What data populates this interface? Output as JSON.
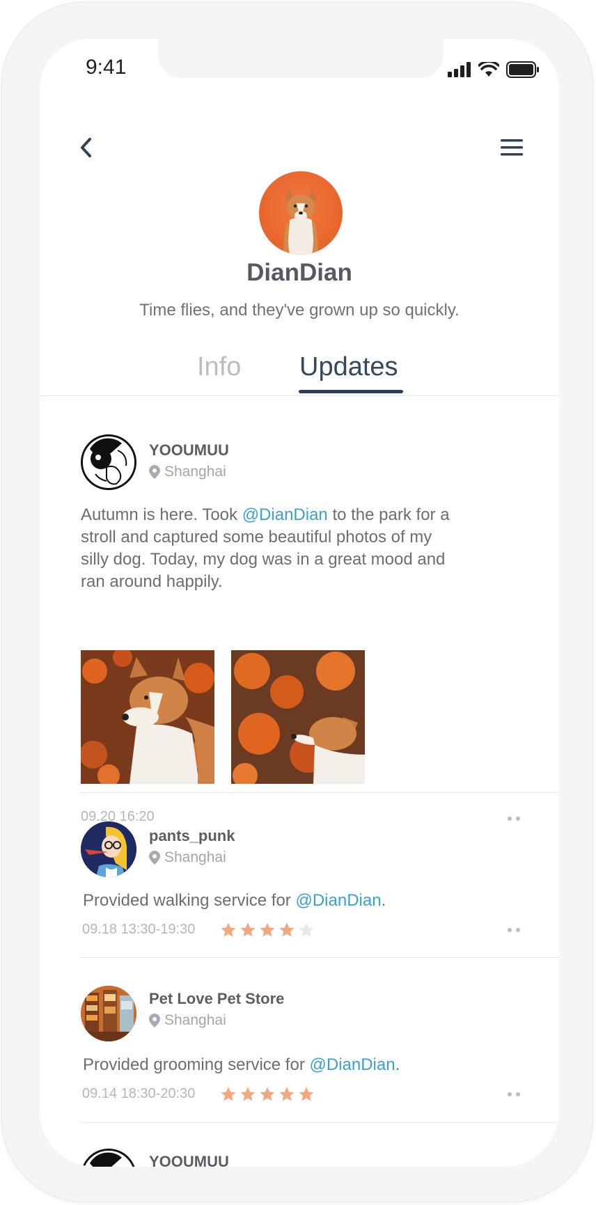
{
  "status": {
    "time": "9:41"
  },
  "profile": {
    "name": "DianDian",
    "bio": "Time flies, and they've grown up so quickly."
  },
  "tabs": [
    {
      "label": "Info",
      "active": false
    },
    {
      "label": "Updates",
      "active": true
    }
  ],
  "posts": [
    {
      "user": "YOOUMUU",
      "location": "Shanghai",
      "text_parts": [
        "Autumn is here. Took ",
        "@DianDian",
        " to the park for a stroll and captured some beautiful photos of my silly dog. Today, my dog was in a great mood and ran around happily."
      ],
      "time": "09.20 16:20"
    },
    {
      "user": "pants_punk",
      "location": "Shanghai",
      "text_parts": [
        "Provided walking service for ",
        "@DianDian",
        "."
      ],
      "time": "09.18 13:30-19:30",
      "rating": 4,
      "rating_max": 5
    },
    {
      "user": "Pet Love Pet Store",
      "location": "Shanghai",
      "text_parts": [
        "Provided grooming service for ",
        "@DianDian",
        "."
      ],
      "time": "09.14 18:30-20:30",
      "rating": 5,
      "rating_max": 5
    },
    {
      "user": "YOOUMUU"
    }
  ],
  "colors": {
    "accent": "#33495d",
    "mention": "#3aa0cf",
    "star_on": "#f4a77e",
    "star_off": "#e4e6e8"
  }
}
